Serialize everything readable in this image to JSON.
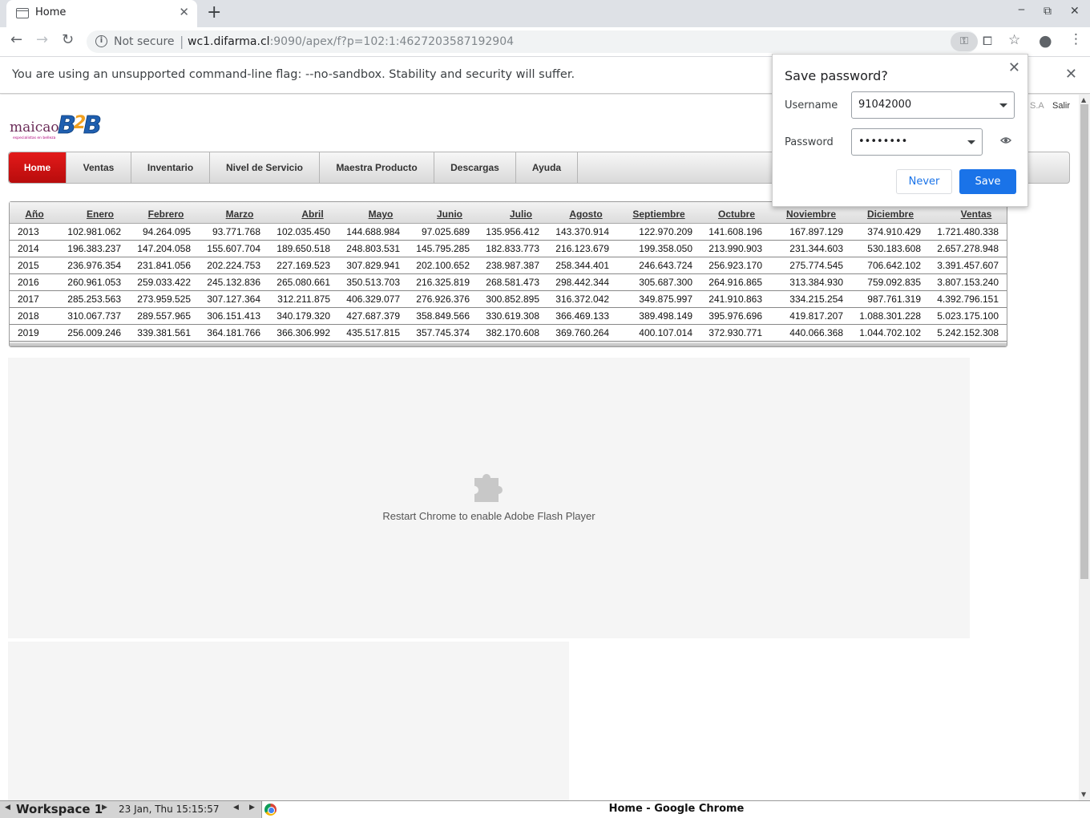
{
  "browser": {
    "tab_title": "Home",
    "security_label": "Not secure",
    "url_host": "wc1.difarma.cl",
    "url_path": ":9090/apex/f?p=102:1:4627203587192904"
  },
  "infobar": {
    "message": "You are using an unsupported command-line flag: --no-sandbox. Stability and security will suffer."
  },
  "page": {
    "top_links": {
      "company_suffix": "S.A",
      "logout": "Salir"
    },
    "nav": [
      "Home",
      "Ventas",
      "Inventario",
      "Nivel de Servicio",
      "Maestra Producto",
      "Descargas",
      "Ayuda"
    ],
    "table": {
      "headers": [
        "Año",
        "Enero",
        "Febrero",
        "Marzo",
        "Abril",
        "Mayo",
        "Junio",
        "Julio",
        "Agosto",
        "Septiembre",
        "Octubre",
        "Noviembre",
        "Diciembre",
        "Ventas"
      ],
      "rows": [
        [
          "2013",
          "102.981.062",
          "94.264.095",
          "93.771.768",
          "102.035.450",
          "144.688.984",
          "97.025.689",
          "135.956.412",
          "143.370.914",
          "122.970.209",
          "141.608.196",
          "167.897.129",
          "374.910.429",
          "1.721.480.338"
        ],
        [
          "2014",
          "196.383.237",
          "147.204.058",
          "155.607.704",
          "189.650.518",
          "248.803.531",
          "145.795.285",
          "182.833.773",
          "216.123.679",
          "199.358.050",
          "213.990.903",
          "231.344.603",
          "530.183.608",
          "2.657.278.948"
        ],
        [
          "2015",
          "236.976.354",
          "231.841.056",
          "202.224.753",
          "227.169.523",
          "307.829.941",
          "202.100.652",
          "238.987.387",
          "258.344.401",
          "246.643.724",
          "256.923.170",
          "275.774.545",
          "706.642.102",
          "3.391.457.607"
        ],
        [
          "2016",
          "260.961.053",
          "259.033.422",
          "245.132.836",
          "265.080.661",
          "350.513.703",
          "216.325.819",
          "268.581.473",
          "298.442.344",
          "305.687.300",
          "264.916.865",
          "313.384.930",
          "759.092.835",
          "3.807.153.240"
        ],
        [
          "2017",
          "285.253.563",
          "273.959.525",
          "307.127.364",
          "312.211.875",
          "406.329.077",
          "276.926.376",
          "300.852.895",
          "316.372.042",
          "349.875.997",
          "241.910.863",
          "334.215.254",
          "987.761.319",
          "4.392.796.151"
        ],
        [
          "2018",
          "310.067.737",
          "289.557.965",
          "306.151.413",
          "340.179.320",
          "427.687.379",
          "358.849.566",
          "330.619.308",
          "366.469.133",
          "389.498.149",
          "395.976.696",
          "419.817.207",
          "1.088.301.228",
          "5.023.175.100"
        ],
        [
          "2019",
          "256.009.246",
          "339.381.561",
          "364.181.766",
          "366.306.992",
          "435.517.815",
          "357.745.374",
          "382.170.608",
          "369.760.264",
          "400.107.014",
          "372.930.771",
          "440.066.368",
          "1.044.702.102",
          "5.242.152.308"
        ]
      ]
    },
    "flash_message": "Restart Chrome to enable Adobe Flash Player"
  },
  "password_bubble": {
    "title": "Save password?",
    "username_label": "Username",
    "username_value": "91042000",
    "password_label": "Password",
    "password_value": "••••••••",
    "never_label": "Never",
    "save_label": "Save"
  },
  "taskbar": {
    "workspace": "Workspace 1",
    "clock": "23 Jan, Thu 15:15:57",
    "task_title": "Home - Google Chrome"
  },
  "icons": [
    "tab-favicon-icon",
    "close-icon",
    "plus-icon",
    "minimize-icon",
    "restore-icon",
    "back-icon",
    "forward-icon",
    "reload-icon",
    "info-icon",
    "key-icon",
    "translate-icon",
    "star-icon",
    "profile-icon",
    "menu-icon",
    "eye-icon",
    "puzzle-icon",
    "chrome-icon"
  ],
  "colors": {
    "nav_active": "#d01010",
    "save_button": "#1a73e8",
    "link_blue": "#1a73e8"
  }
}
